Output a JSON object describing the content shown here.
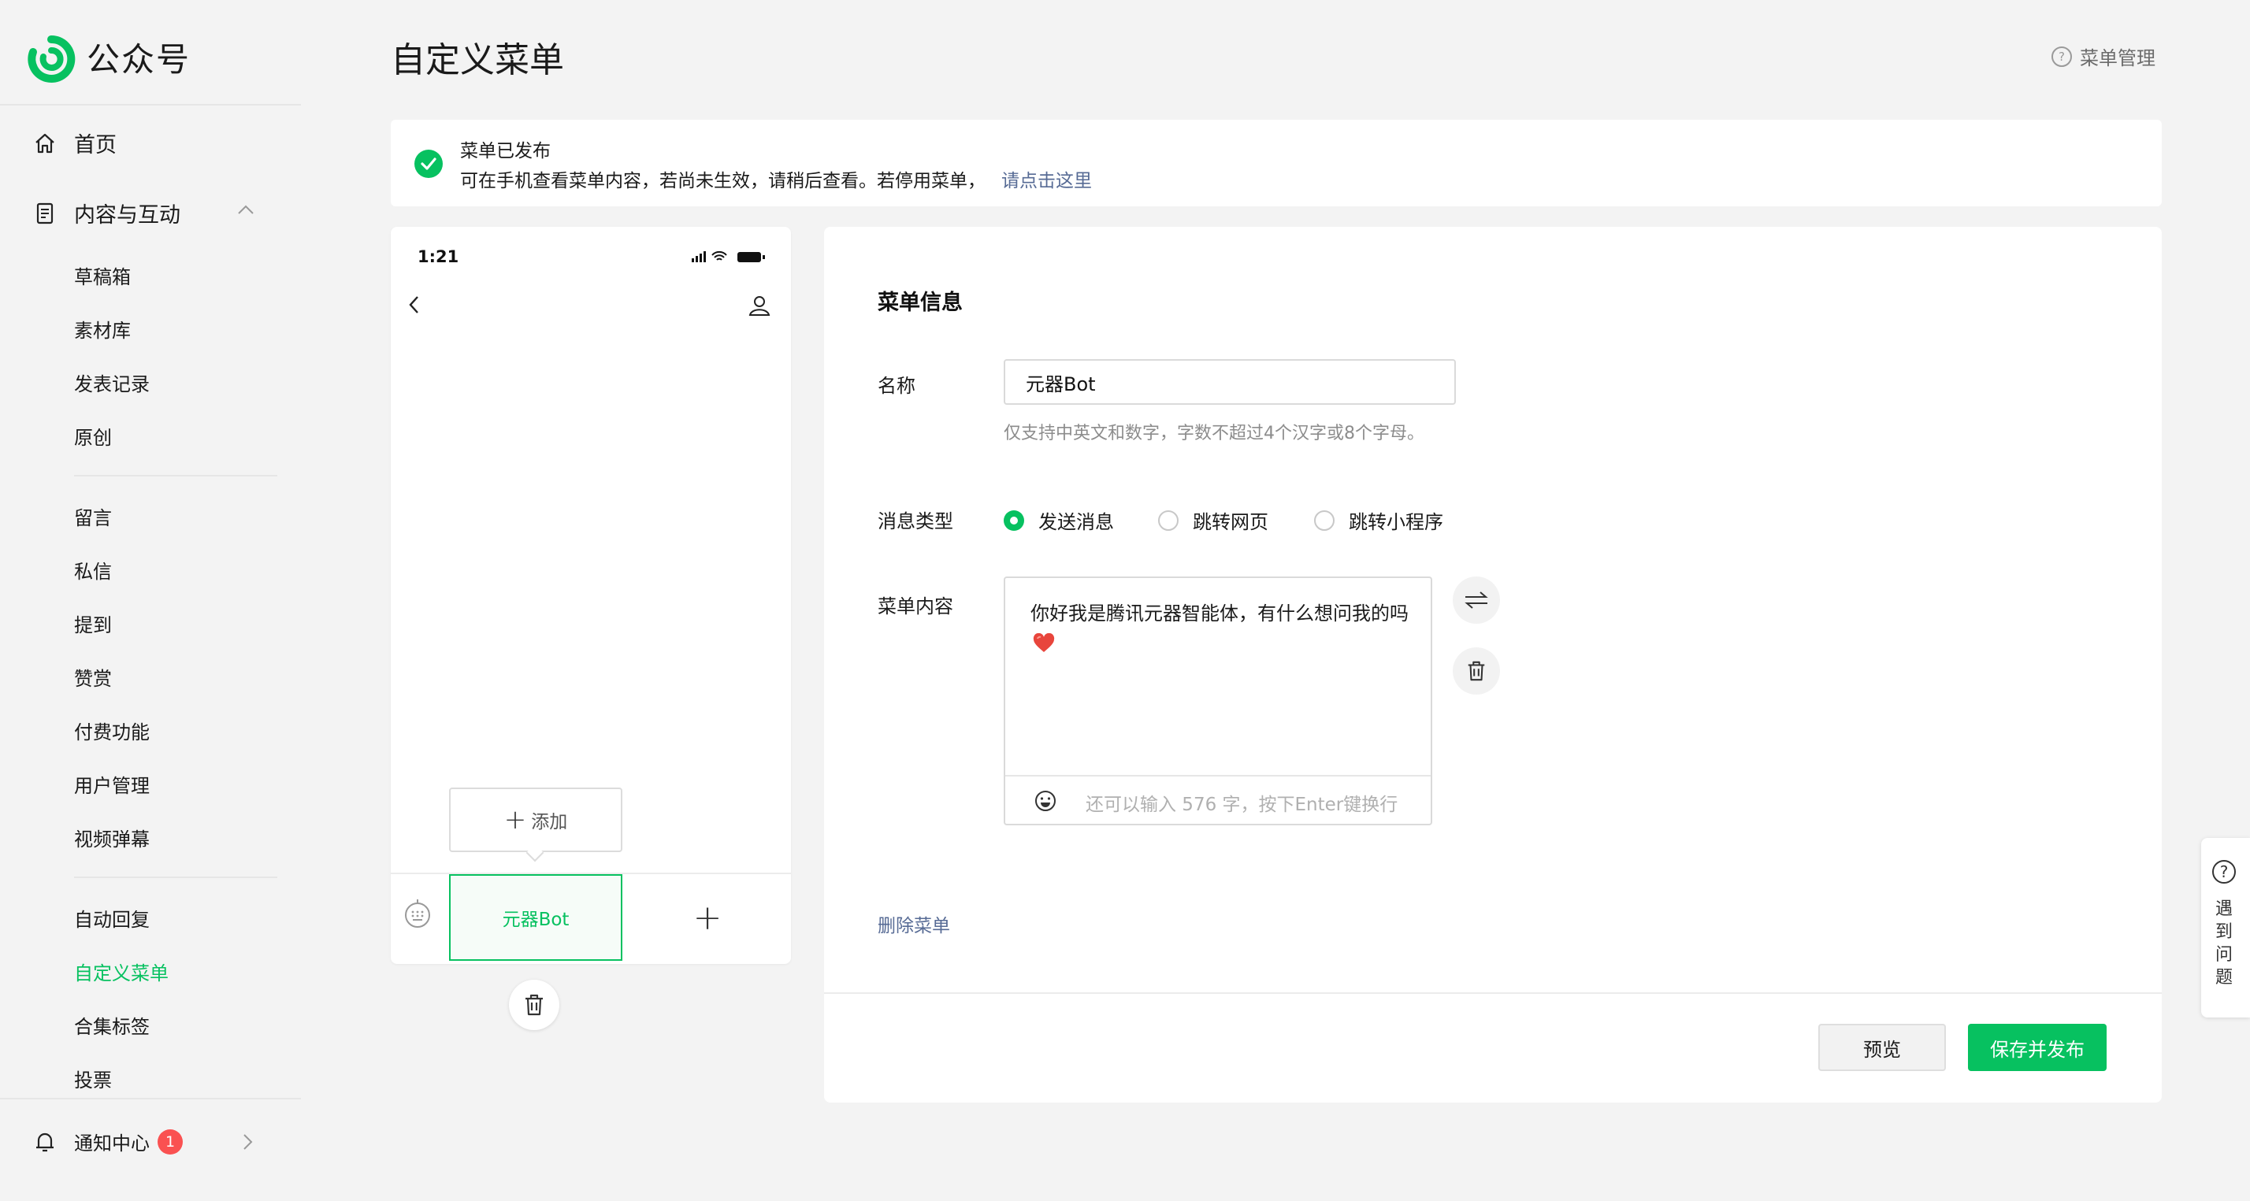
{
  "app": {
    "name": "公众号"
  },
  "sidebar": {
    "home": "首页",
    "content_group": "内容与互动",
    "content_items": [
      "草稿箱",
      "素材库",
      "发表记录",
      "原创"
    ],
    "interact_items": [
      "留言",
      "私信",
      "提到",
      "赞赏",
      "付费功能",
      "用户管理",
      "视频弹幕"
    ],
    "tool_items": [
      "自动回复",
      "自定义菜单",
      "合集标签",
      "投票"
    ],
    "active_item": "自定义菜单",
    "notification": {
      "label": "通知中心",
      "count": "1"
    }
  },
  "header": {
    "title": "自定义菜单",
    "menu_management": "菜单管理"
  },
  "notice": {
    "title": "菜单已发布",
    "desc": "可在手机查看菜单内容，若尚未生效，请稍后查看。若停用菜单，",
    "link": "请点击这里"
  },
  "phone": {
    "time": "1:21",
    "add_label": "添加",
    "menu_item": "元器Bot"
  },
  "panel": {
    "section_title": "菜单信息",
    "name_label": "名称",
    "name_value": "元器Bot",
    "name_hint": "仅支持中英文和数字，字数不超过4个汉字或8个字母。",
    "type_label": "消息类型",
    "type_options": [
      "发送消息",
      "跳转网页",
      "跳转小程序"
    ],
    "type_selected": "发送消息",
    "content_label": "菜单内容",
    "content_text": "你好我是腾讯元器智能体，有什么想问我的吗",
    "counter_text": "还可以输入 576 字，按下Enter键换行",
    "delete_menu": "删除菜单",
    "preview_button": "预览",
    "publish_button": "保存并发布"
  },
  "help": {
    "text": "遇到问题"
  },
  "colors": {
    "brand_green": "#07c160",
    "link_blue": "#576b95",
    "badge_red": "#fa5151"
  }
}
